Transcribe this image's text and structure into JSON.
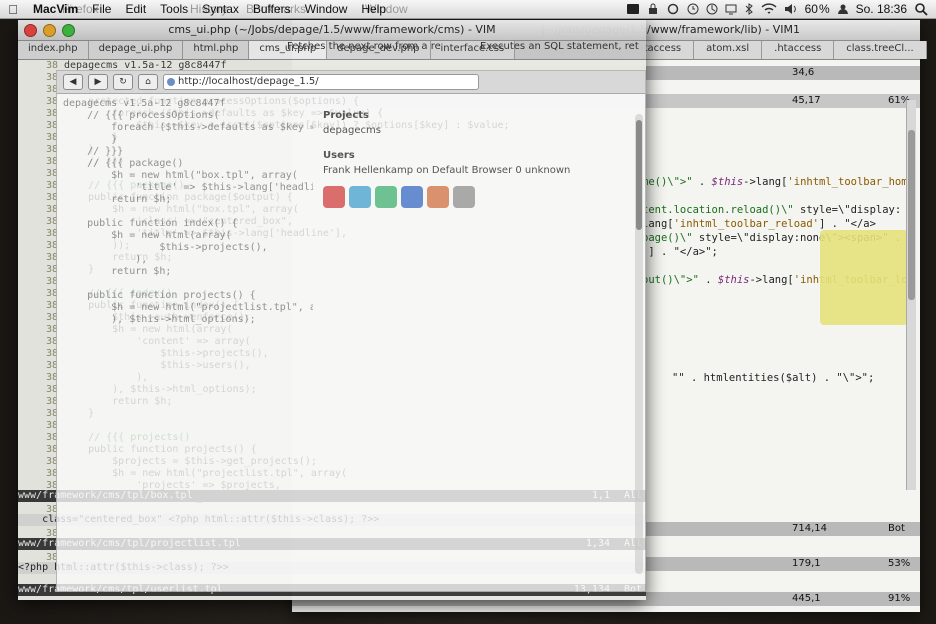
{
  "menubar": {
    "items": [
      "MacVim",
      "File",
      "Edit",
      "Tools",
      "Syntax",
      "Buffers",
      "Window",
      "Help"
    ],
    "ghost_items": [
      "Firefox",
      "History",
      "Bookmarks",
      "Window"
    ],
    "clock": "So. 18:36",
    "battery": "60"
  },
  "vim_right": {
    "title": "(~/Jobs/depage/1.5/www/framework/lib) - VIM1",
    "tabs": [
      ".htaccess",
      "atom.xsl",
      ".htaccess",
      "class.treeCl..."
    ],
    "status_top": {
      "pos": "34,6",
      "pct": ""
    },
    "status_mid": {
      "pos": "45,17",
      "pct": "61%"
    },
    "lines": [
      {
        "a": "<span class=\"kw\">me()\\\"&gt;\"</span> . <span class=\"var\">$this</span>-&gt;lang[<span class=\"str\">'inhtml_toolbar_home'</span>] . \"&lt;/",
        "n": 1
      },
      {
        "a": "",
        "n": 2
      },
      {
        "a": "<span class=\"kw\">tent.location.reload()\\\"</span> style=\\\"display:",
        "n": 3
      },
      {
        "a": "lang[<span class=\"str\">'inhtml_toolbar_reload'</span>] . \"&lt;/a&gt;",
        "n": 4
      },
      {
        "a": "<span class=\"kw\">page()\\\"</span> style=\\\"display:none\\\"&gt;&lt;span&gt;\" . <span class=\"var\">$this-</span>",
        "n": 5
      },
      {
        "a": "'] . \"&lt;/a&gt;\";",
        "n": 6
      },
      {
        "a": "",
        "n": 7
      },
      {
        "a": "<span class=\"kw\">out()\\\"&gt;\"</span> . <span class=\"var\">$this</span>-&gt;lang[<span class=\"str\">'inhtml_toolbar_logout'</span>] .",
        "n": 8
      }
    ],
    "line_htmlentities": "\"\" . htmlentities($alt) . \"\\\">\";",
    "status_lower": [
      {
        "pos": "714,14",
        "pct": "Bot"
      },
      {
        "pos": "179,1",
        "pct": "53%"
      },
      {
        "pos": "445,1",
        "pct": "91%"
      }
    ]
  },
  "vim_left": {
    "title": "cms_ui.php (~/Jobs/depage/1.5/www/framework/cms) - VIM",
    "tabs": [
      "index.php",
      "depage_ui.php",
      "html.php",
      "cms_ui.php",
      "depage_dev.php",
      "interface.css"
    ],
    "gutter": [
      "38",
      "38",
      "38",
      "38",
      "38",
      "38",
      "38",
      "38",
      "38",
      "38",
      "38",
      "38",
      "38",
      "38",
      "38",
      "38",
      "38",
      "38",
      "38",
      "38",
      "38",
      "38",
      "38",
      "38",
      "38",
      "38",
      "38",
      "38",
      "38",
      "38",
      "38",
      "38",
      "38",
      "38",
      "38",
      "38",
      "38",
      "38",
      "38",
      "38",
      "38",
      "38"
    ],
    "code": [
      "depagecms v1.5a-12 g8c8447f",
      "",
      "    // {{{ processOptions(",
      "    protected function processOptions($options) {",
      "        foreach ($this->defaults as $key => $value) {",
      "            $this->$key = isset($options[$key]) ? $options[$key] : $value;",
      "        }",
      "    }",
      "    // }}}",
      "",
      "    // {{{ package()",
      "    public function package($output) {",
      "        $h = new html(\"box.tpl\", array(",
      "            'class' => \"centered_box\",",
      "            'title' => $this->lang['headline'],",
      "        ));",
      "        return $h;",
      "    }",
      "",
      "    // {{{ index()",
      "    public function index() {",
      "        $this->auth->enforce();",
      "        $h = new html(array(",
      "            'content' => array(",
      "                $this->projects(),",
      "                $this->users(),",
      "            ),",
      "        ), $this->html_options);",
      "        return $h;",
      "    }",
      "",
      "    // {{{ projects()",
      "    public function projects() {",
      "        $projects = $this->get_projects();",
      "        $h = new html(\"projectlist.tpl\", array(",
      "            'projects' => $projects,",
      "        ), $this->html_options);"
    ],
    "bottom_bars": [
      {
        "text": "www/framework/cms/tpl/box.tpl",
        "pos": "1,1",
        "pct": "All",
        "dark": true
      },
      {
        "text": "    class=\"centered_box\" <?php html::attr($this->class); ?>>",
        "pos": "",
        "pct": "",
        "dark": false
      },
      {
        "text": "www/framework/cms/tpl/projectlist.tpl",
        "pos": "1,34",
        "pct": "All",
        "dark": true
      },
      {
        "text": "<?php html::attr($this->class); ?>>",
        "pos": "",
        "pct": "",
        "dark": false
      },
      {
        "text": "www/framework/cms/tpl/userlist.tpl",
        "pos": "13,134",
        "pct": "Bot",
        "dark": true
      }
    ]
  },
  "browser": {
    "url": "http://localhost/depage_1.5/",
    "tabs": [
      "Fetches the next row from a re",
      "Executes an SQL statement, ret"
    ],
    "side_headings": [
      "Projects",
      "Users"
    ],
    "side_items": [
      "depagecms",
      "Frank Hellenkamp on Default Browser 0 unknown"
    ]
  }
}
